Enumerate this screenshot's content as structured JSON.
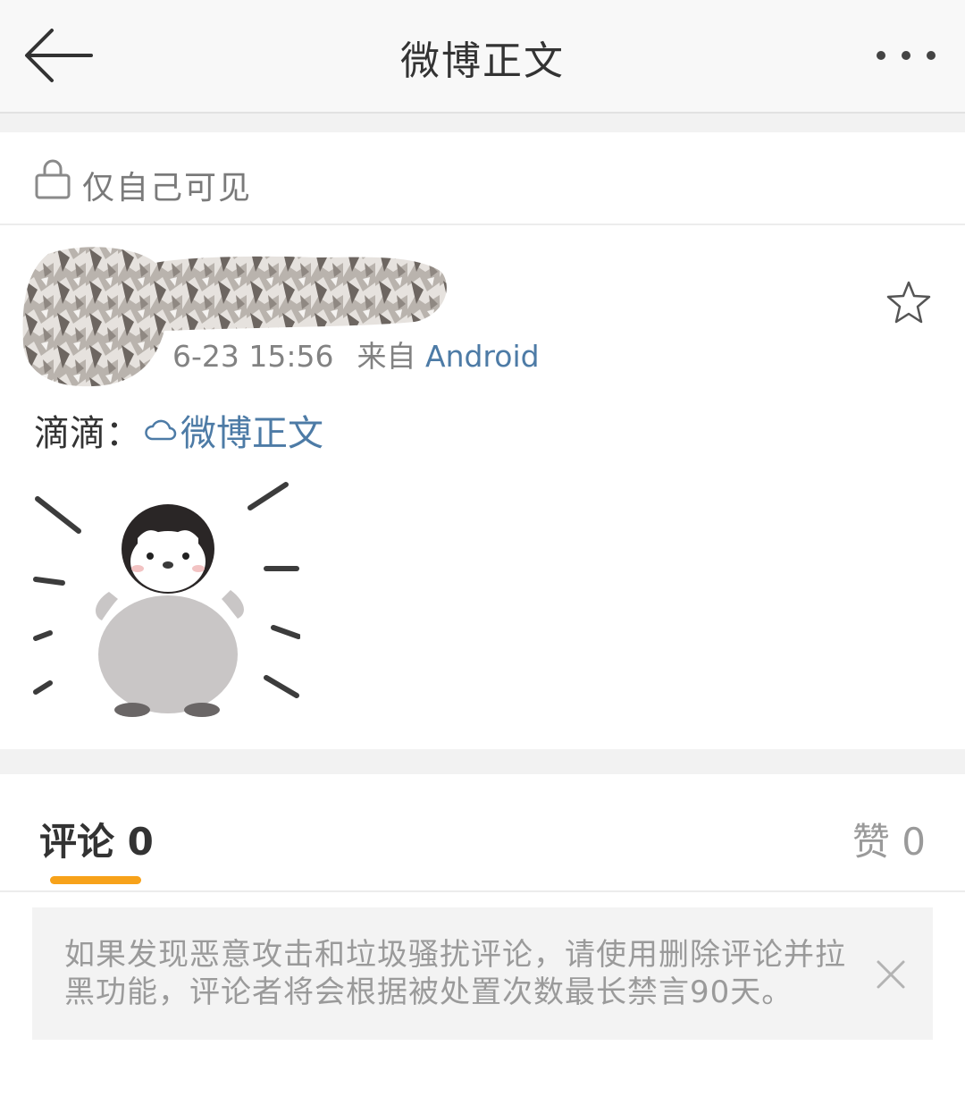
{
  "header": {
    "title": "微博正文",
    "back_icon": "arrow-left-icon",
    "more_icon": "more-dots-icon"
  },
  "visibility": {
    "icon": "lock-icon",
    "label": "仅自己可见"
  },
  "post": {
    "time": "6-23 15:56",
    "source_prefix": "来自",
    "source": "Android",
    "author": "滴滴：",
    "link_icon": "cloud-icon",
    "link_text": "微博正文",
    "favorite_icon": "star-icon",
    "image": "penguin-sticker"
  },
  "comments": {
    "tab_label": "评论 0",
    "likes_label": "赞 0",
    "accent_color": "#f7a21a",
    "notice": "如果发现恶意攻击和垃圾骚扰评论，请使用删除评论并拉黑功能，评论者将会根据被处置次数最长禁言90天。",
    "close_icon": "close-icon"
  },
  "colors": {
    "link": "#4d7ba6",
    "muted": "#828282"
  }
}
